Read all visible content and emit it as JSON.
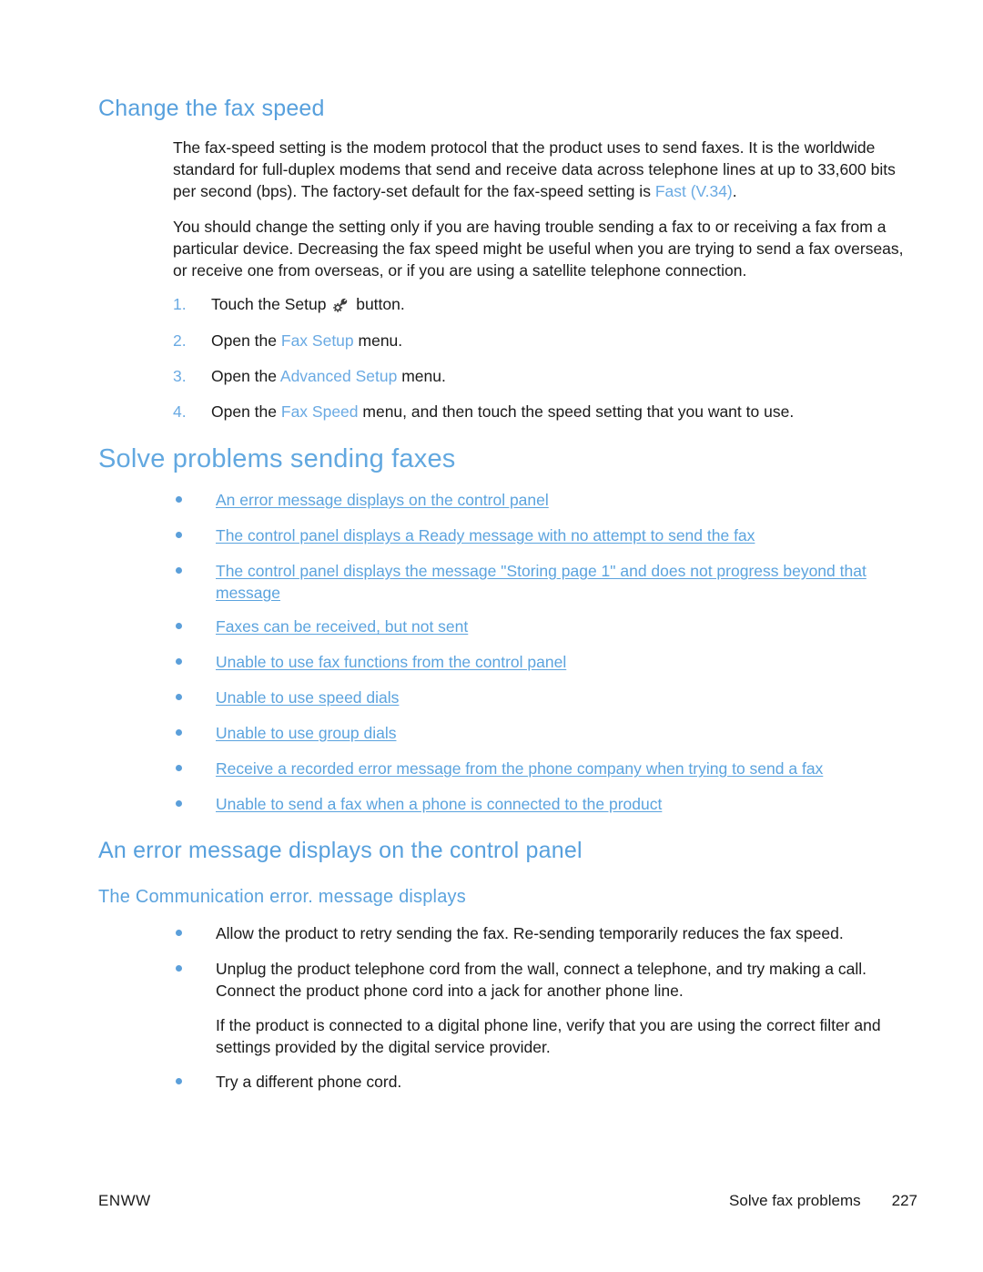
{
  "document": {
    "section_heading": "Change the fax speed",
    "intro_paragraph_1_before": "The fax-speed setting is the modem protocol that the product uses to send faxes. It is the worldwide standard for full-duplex modems that send and receive data across telephone lines at up to 33,600 bits per second (bps). The factory-set default for the fax-speed setting is ",
    "intro_paragraph_1_highlight": "Fast (V.34)",
    "intro_paragraph_1_after": ".",
    "intro_paragraph_2": "You should change the setting only if you are having trouble sending a fax to or receiving a fax from a particular device. Decreasing the fax speed might be useful when you are trying to send a fax overseas, or receive one from overseas, or if you are using a satellite telephone connection.",
    "steps": [
      {
        "number": "1.",
        "text_before": "Touch the Setup ",
        "icon": "setup-wrench-gear-icon",
        "text_after": " button.",
        "highlight": ""
      },
      {
        "number": "2.",
        "text_before": "Open the ",
        "highlight": "Fax Setup",
        "text_after": " menu."
      },
      {
        "number": "3.",
        "text_before": "Open the ",
        "highlight": "Advanced Setup",
        "text_after": " menu."
      },
      {
        "number": "4.",
        "text_before": "Open the ",
        "highlight": "Fax Speed",
        "text_after": " menu, and then touch the speed setting that you want to use."
      }
    ],
    "main_heading": "Solve problems sending faxes",
    "toc_links": [
      "An error message displays on the control panel",
      "The control panel displays a Ready message with no attempt to send the fax",
      "The control panel displays the message \"Storing page 1\" and does not progress beyond that message",
      "Faxes can be received, but not sent",
      "Unable to use fax functions from the control panel",
      "Unable to use speed dials",
      "Unable to use group dials",
      "Receive a recorded error message from the phone company when trying to send a fax",
      "Unable to send a fax when a phone is connected to the product"
    ],
    "subsection_heading": "An error message displays on the control panel",
    "subsubsection_heading": "The Communication error. message displays",
    "troubleshoot_bullets": [
      "Allow the product to retry sending the fax. Re-sending temporarily reduces the fax speed.",
      "Unplug the product telephone cord from the wall, connect a telephone, and try making a call. Connect the product phone cord into a jack for another phone line.",
      "Try a different phone cord."
    ],
    "troubleshoot_note": "If the product is connected to a digital phone line, verify that you are using the correct filter and settings provided by the digital service provider."
  },
  "footer": {
    "left": "ENWW",
    "section": "Solve fax problems",
    "page_number": "227"
  },
  "colors": {
    "heading_blue": "#62a8e0",
    "subheading_blue": "#57a0dd",
    "link_blue": "#5ba3de",
    "bullet_blue": "#5b9fda",
    "body_text": "#1a1a1a"
  }
}
